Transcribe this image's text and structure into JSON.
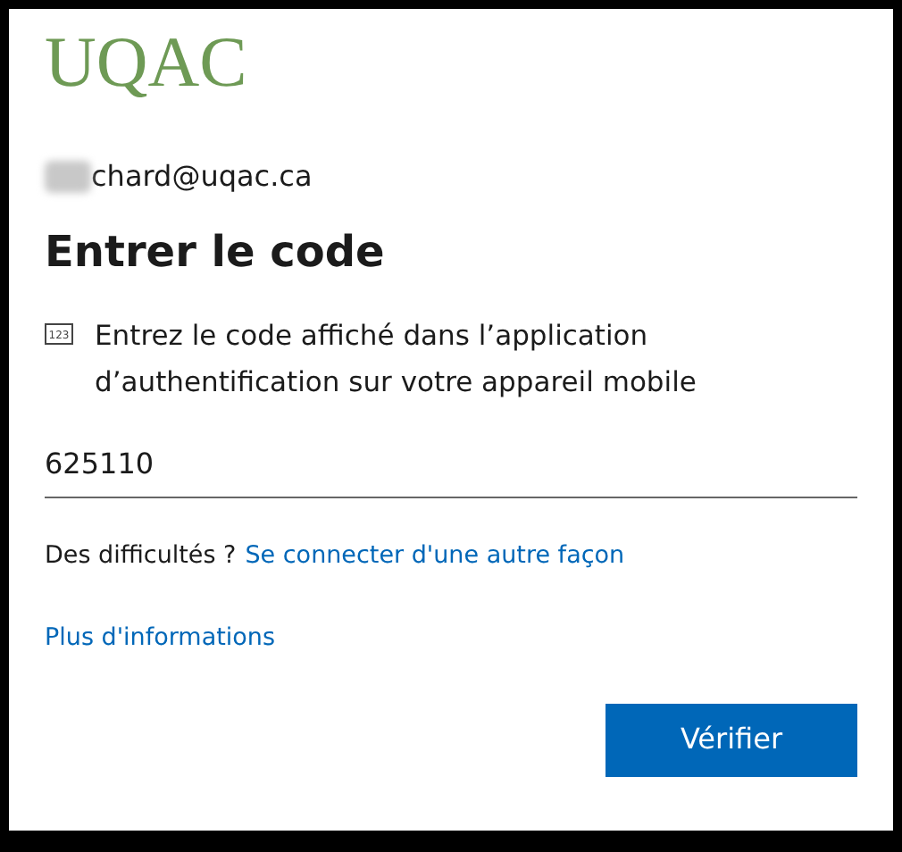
{
  "logo": "UQAC",
  "account": {
    "email": "chard@uqac.ca",
    "redacted_prefix": true
  },
  "title": "Entrer le code",
  "instruction": {
    "icon_label": "123",
    "text": "Entrez le code affiché dans l’application d’authentification sur votre appareil mobile"
  },
  "code_field": {
    "value": "625110"
  },
  "help": {
    "text": "Des difficultés ?",
    "link": "Se connecter d'une autre façon"
  },
  "more_link": "Plus d'informations",
  "buttons": [
    "Vérifier"
  ]
}
